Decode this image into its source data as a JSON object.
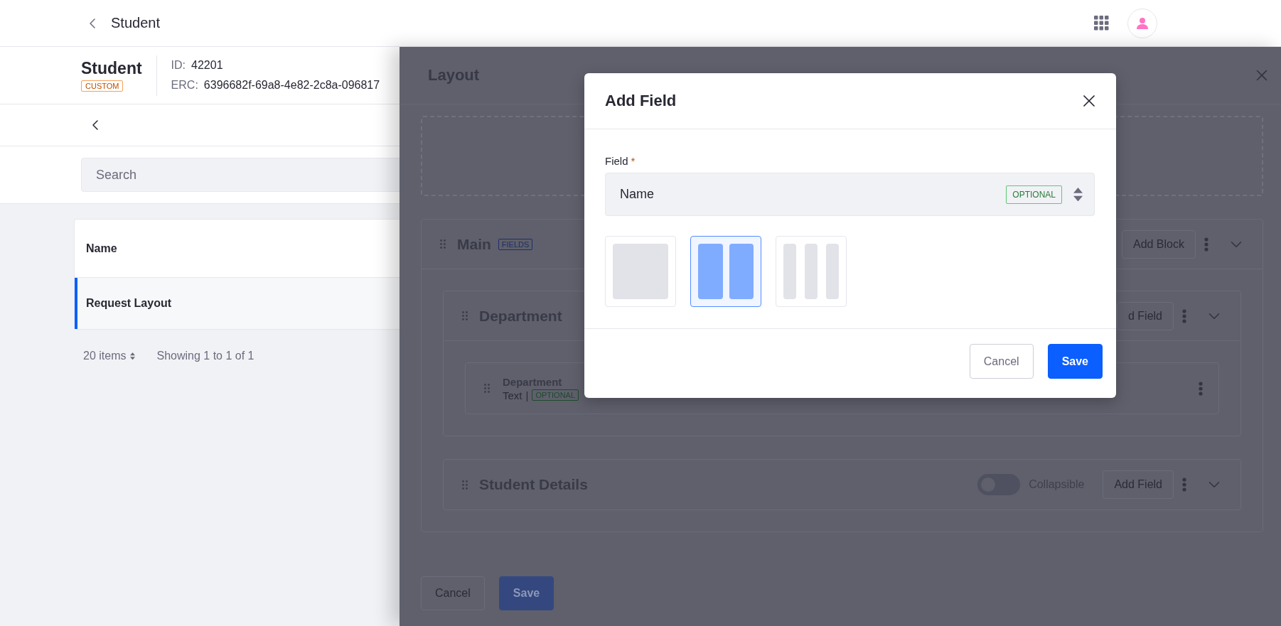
{
  "top_bar": {
    "title": "Student"
  },
  "object_header": {
    "title": "Student",
    "badge": "CUSTOM",
    "id_label": "ID:",
    "id_value": "42201",
    "erc_label": "ERC:",
    "erc_value": "6396682f-69a8-4e82-2c8a-096817"
  },
  "search": {
    "placeholder": "Search"
  },
  "table": {
    "columns": [
      "Name"
    ],
    "rows": [
      {
        "name": "Request Layout",
        "selected": true
      }
    ]
  },
  "pagination": {
    "per_page": "20 items",
    "summary": "Showing 1 to 1 of 1"
  },
  "layout_panel": {
    "title": "Layout",
    "tab": {
      "name": "Main",
      "badge": "FIELDS",
      "action": "Add Block",
      "expanded": true,
      "blocks": [
        {
          "name": "Department",
          "action": "d Field",
          "expanded": true,
          "fields": [
            {
              "name": "Department",
              "type": "Text",
              "separator": "|",
              "badge": "OPTIONAL"
            }
          ]
        },
        {
          "name": "Student Details",
          "toggle": {
            "label": "Collapsible",
            "on": false
          },
          "action": "Add Field",
          "expanded": false
        }
      ]
    },
    "buttons": [
      {
        "label": "Cancel",
        "kind": "secondary"
      },
      {
        "label": "Save",
        "kind": "primary"
      }
    ]
  },
  "modal": {
    "title": "Add Field",
    "field_label": "Field",
    "required_mark": "*",
    "select": {
      "value": "Name",
      "badge": "OPTIONAL"
    },
    "column_options": [
      {
        "kind": "one",
        "selected": false
      },
      {
        "kind": "two",
        "selected": true
      },
      {
        "kind": "three",
        "selected": false
      }
    ],
    "buttons": [
      {
        "label": "Cancel",
        "kind": "secondary"
      },
      {
        "label": "Save",
        "kind": "primary"
      }
    ]
  }
}
